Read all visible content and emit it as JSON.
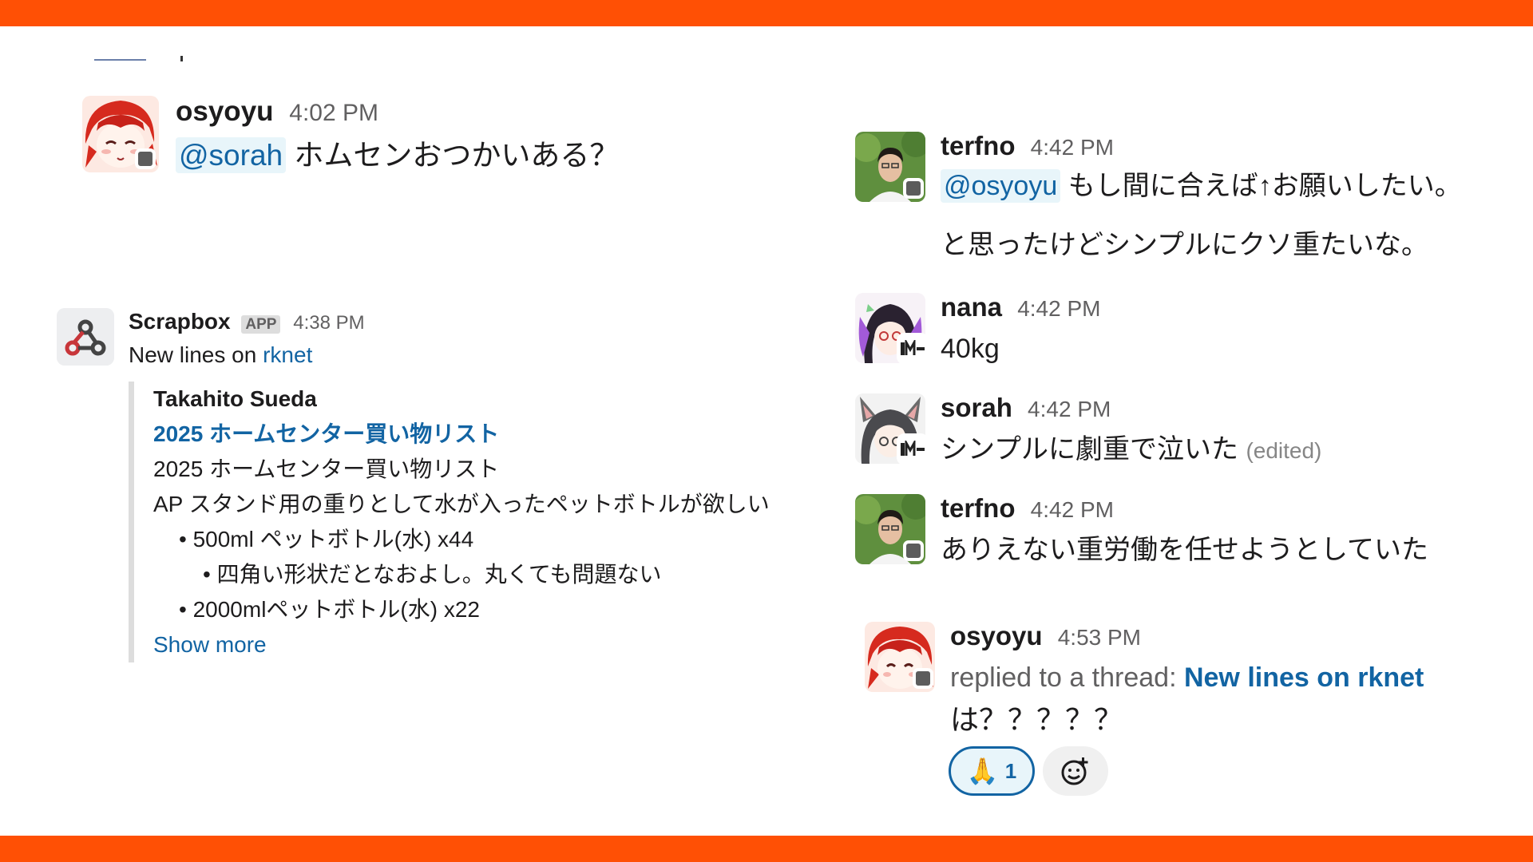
{
  "colors": {
    "brand_bar": "#ff5005",
    "link": "#1264a3",
    "mention_bg": "#e8f5fa",
    "presence": "#5c5c5c"
  },
  "messages": {
    "m1": {
      "user": "osyoyu",
      "time": "4:02 PM",
      "mention": "@sorah",
      "text": "ホムセンおつかいある？"
    },
    "scrapbox": {
      "user": "Scrapbox",
      "badge": "APP",
      "time": "4:38 PM",
      "text_prefix": "New lines on ",
      "text_link": "rknet",
      "attachment": {
        "author": "Takahito Sueda",
        "title": "2025 ホームセンター買い物リスト",
        "lines": [
          "2025 ホームセンター買い物リスト",
          "AP スタンド用の重りとして水が入ったペットボトルが欲しい",
          "• 500ml ペットボトル(水) x44",
          "• 四角い形状だとなおよし。丸くても問題ない",
          "• 2000mlペットボトル(水) x22"
        ],
        "show_more": "Show more"
      }
    },
    "m2": {
      "user": "terfno",
      "time": "4:42 PM",
      "mention": "@osyoyu",
      "text": "もし間に合えば↑お願いしたい。",
      "text2": "と思ったけどシンプルにクソ重たいな。"
    },
    "m3": {
      "user": "nana",
      "time": "4:42 PM",
      "text": "40kg"
    },
    "m4": {
      "user": "sorah",
      "time": "4:42 PM",
      "text": "シンプルに劇重で泣いた",
      "edited": "(edited)"
    },
    "m5": {
      "user": "terfno",
      "time": "4:42 PM",
      "text": "ありえない重労働を任せようとしていた"
    },
    "m6": {
      "user": "osyoyu",
      "time": "4:53 PM",
      "replied_prefix": "replied to a thread: ",
      "replied_link": "New lines on rknet",
      "text": "は？？？？？",
      "reactions": [
        {
          "emoji": "🙏",
          "count": "1"
        }
      ],
      "add_reaction_icon": "add-emoji-icon"
    }
  }
}
